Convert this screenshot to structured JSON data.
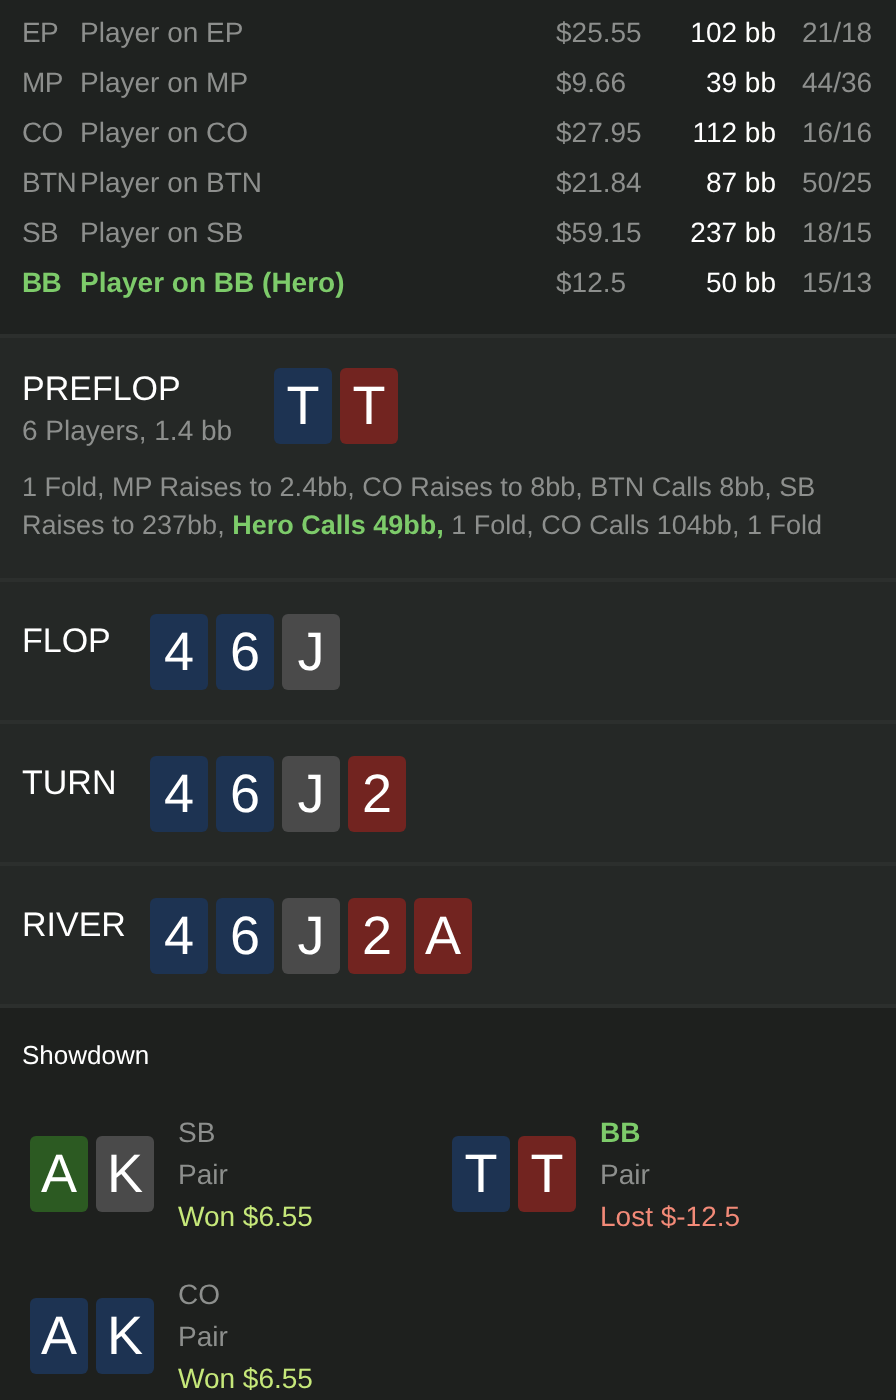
{
  "players": [
    {
      "position": "EP",
      "name": "Player on EP",
      "stack": "$25.55",
      "bb": "102 bb",
      "stats": "21/18",
      "hero": false
    },
    {
      "position": "MP",
      "name": "Player on MP",
      "stack": "$9.66",
      "bb": "39 bb",
      "stats": "44/36",
      "hero": false
    },
    {
      "position": "CO",
      "name": "Player on CO",
      "stack": "$27.95",
      "bb": "112 bb",
      "stats": "16/16",
      "hero": false
    },
    {
      "position": "BTN",
      "name": "Player on BTN",
      "stack": "$21.84",
      "bb": "87 bb",
      "stats": "50/25",
      "hero": false
    },
    {
      "position": "SB",
      "name": "Player on SB",
      "stack": "$59.15",
      "bb": "237 bb",
      "stats": "18/15",
      "hero": false
    },
    {
      "position": "BB",
      "name": "Player on BB (Hero)",
      "stack": "$12.5",
      "bb": "50 bb",
      "stats": "15/13",
      "hero": true
    }
  ],
  "streets": [
    {
      "title": "PREFLOP",
      "subtitle": "6 Players, 1.4 bb",
      "cards": [
        {
          "rank": "T",
          "color": "#1d3352"
        },
        {
          "rank": "T",
          "color": "#722420"
        }
      ],
      "actions": "1 Fold, MP Raises to 2.4bb, CO Raises to 8bb, BTN Calls 8bb, SB Raises to 237bb, **Hero Calls 49bb,** 1 Fold, CO Calls 104bb, 1 Fold"
    },
    {
      "title": "FLOP",
      "cards": [
        {
          "rank": "4",
          "color": "#1d3352"
        },
        {
          "rank": "6",
          "color": "#1d3352"
        },
        {
          "rank": "J",
          "color": "#4a4a4a"
        }
      ]
    },
    {
      "title": "TURN",
      "cards": [
        {
          "rank": "4",
          "color": "#1d3352"
        },
        {
          "rank": "6",
          "color": "#1d3352"
        },
        {
          "rank": "J",
          "color": "#4a4a4a"
        },
        {
          "rank": "2",
          "color": "#722420"
        }
      ]
    },
    {
      "title": "RIVER",
      "cards": [
        {
          "rank": "4",
          "color": "#1d3352"
        },
        {
          "rank": "6",
          "color": "#1d3352"
        },
        {
          "rank": "J",
          "color": "#4a4a4a"
        },
        {
          "rank": "2",
          "color": "#722420"
        },
        {
          "rank": "A",
          "color": "#722420"
        }
      ]
    }
  ],
  "showdown": {
    "title": "Showdown",
    "hands": [
      {
        "position": "SB",
        "hero": false,
        "hand": "Pair",
        "result": "Won $6.55",
        "won": true,
        "cards": [
          {
            "rank": "A",
            "color": "#2c5a22"
          },
          {
            "rank": "K",
            "color": "#4a4a4a"
          }
        ]
      },
      {
        "position": "BB",
        "hero": true,
        "hand": "Pair",
        "result": "Lost $-12.5",
        "won": false,
        "cards": [
          {
            "rank": "T",
            "color": "#1d3352"
          },
          {
            "rank": "T",
            "color": "#722420"
          }
        ]
      },
      {
        "position": "CO",
        "hero": false,
        "hand": "Pair",
        "result": "Won $6.55",
        "won": true,
        "cards": [
          {
            "rank": "A",
            "color": "#1d3352"
          },
          {
            "rank": "K",
            "color": "#1d3352"
          }
        ]
      }
    ]
  }
}
